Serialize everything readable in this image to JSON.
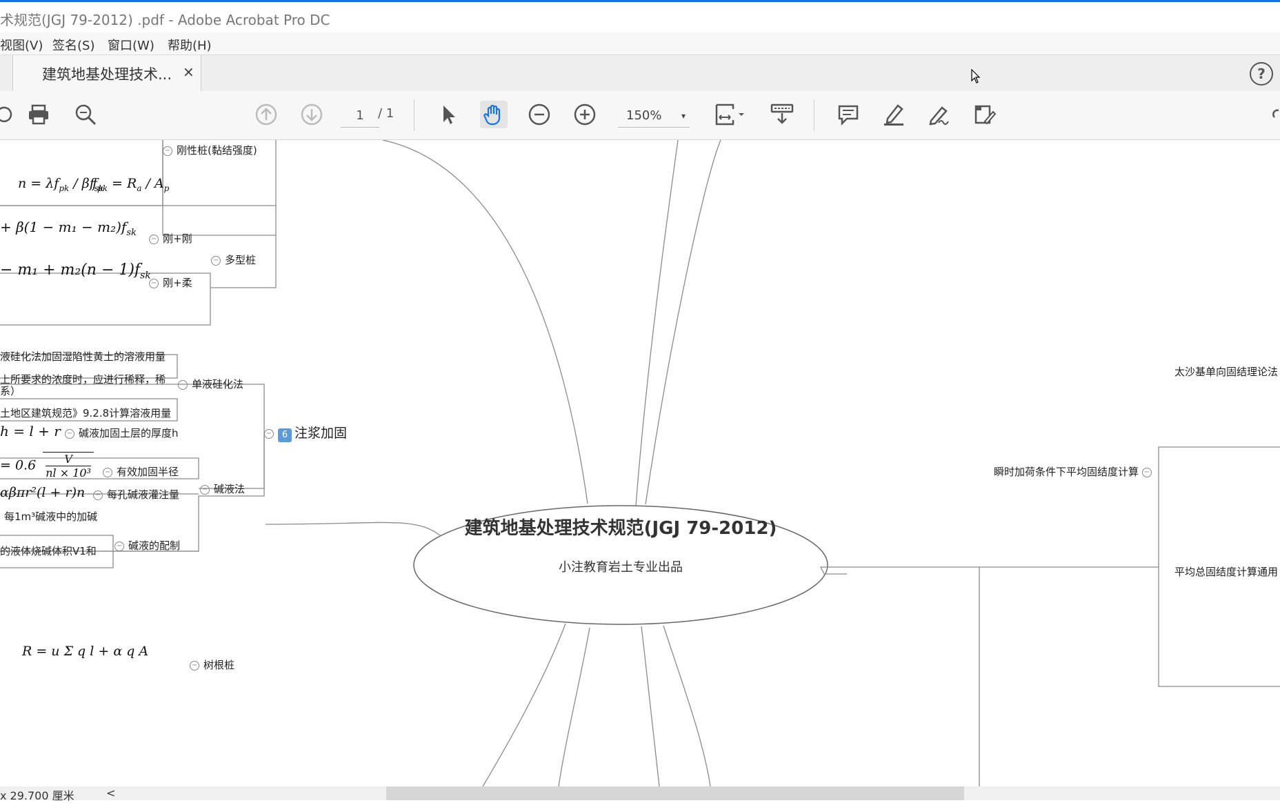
{
  "window": {
    "title": "术规范(JGJ 79-2012) .pdf - Adobe Acrobat Pro DC"
  },
  "menu": {
    "view": "视图(V)",
    "sign": "签名(S)",
    "window": "窗口(W)",
    "help": "帮助(H)"
  },
  "tab": {
    "label": "建筑地基处理技术...",
    "close": "×"
  },
  "help_icon": "?",
  "toolbar": {
    "page_current": "1",
    "page_total": "/ 1",
    "zoom": "150%",
    "zoom_caret": "▾"
  },
  "mindmap": {
    "center_title": "建筑地基处理技术规范(JGJ 79-2012)",
    "center_subtitle": "小注教育岩土专业出品",
    "nodes": {
      "rigid_pile": "刚性桩(黏结强度)",
      "rigid_rigid": "刚+刚",
      "multi_pile": "多型桩",
      "rigid_flex": "刚+柔",
      "silic_note1": "液硅化法加固湿陷性黄土的溶液用量",
      "silic_note2": "上所要求的浓度时，应进行稀释，稀",
      "silic_note2b": "系）",
      "single_silic": "单液硅化法",
      "silic_note3": "土地区建筑规范》9.2.8计算溶液用量",
      "grout_badge": "6",
      "grout": "注浆加固",
      "alkali_thick": "碱液加固土层的厚度h",
      "effective_radius": "有效加固半径",
      "alkali_method": "碱液法",
      "per_hole": "每孔碱液灌注量",
      "per_m3": "每1m³碱液中的加碱",
      "alkali_prep": "碱液的配制",
      "liquid_naoh": "的液体烧碱体积V1和",
      "root_pile": "树根桩",
      "instant_load": "瞬时加荷条件下平均固结度计算",
      "terzaghi": "太沙基单向固结理论法",
      "avg_consol": "平均总固结度计算通用"
    },
    "formulas": {
      "f1a": "n = λf",
      "f1b": "f",
      "f2": "+ β(1 − m₁ − m₂)f",
      "f3": "− m₁ + m₂(n − 1)f",
      "f4": "h = l + r",
      "f5a": "= 0.6",
      "f5b": "V",
      "f5c": "nl × 10³",
      "f6": "αβπr²(l + r)n",
      "f7": "R  = u  Σ q  l   + α q A"
    }
  },
  "status": {
    "size": "x 29.700 厘米",
    "arrow": "<"
  }
}
